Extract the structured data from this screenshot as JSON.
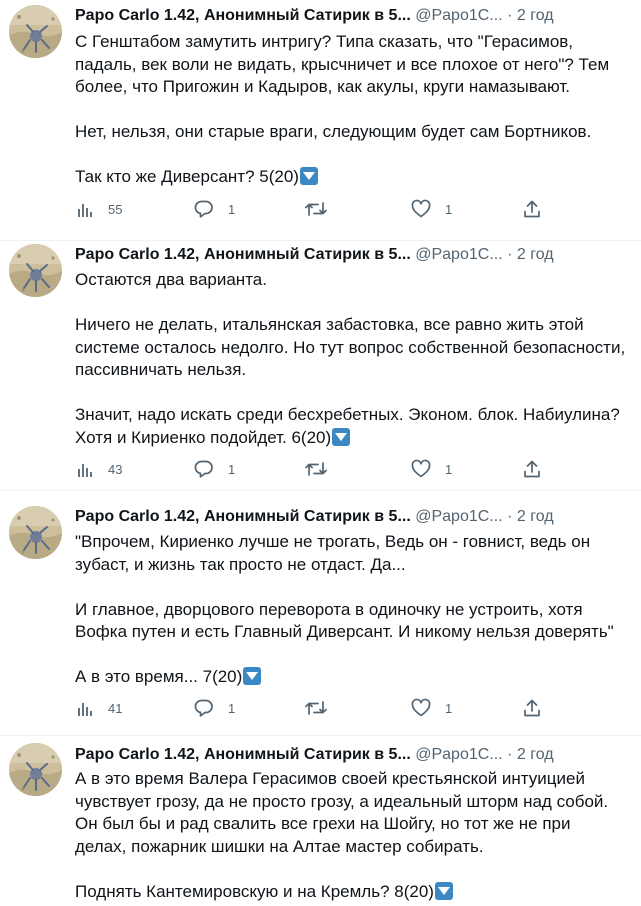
{
  "tweets": [
    {
      "author": "Papo Carlo 1.42, Анонимный Сатирик в 5...",
      "handle": "@Papo1C...",
      "dot": "·",
      "time": "2 год",
      "paragraphs": [
        "С Генштабом замутить интригу? Типа сказать, что \"Герасимов,\nпадаль, век воли не видать, крысчничет и все плохое от него\"? Тем\nболее, что Пригожин и Кадыров, как акулы, круги намазывают.",
        "Нет, нельзя, они старые враги, следующим будет сам Бортников.",
        "Так кто же Диверсант? 5(20)"
      ],
      "views": "55",
      "replies": "1",
      "retweets": "",
      "likes": "1"
    },
    {
      "author": "Papo Carlo 1.42, Анонимный Сатирик в 5...",
      "handle": "@Papo1C...",
      "dot": "·",
      "time": "2 год",
      "paragraphs": [
        "Остаются два варианта.",
        "Ничего не делать, итальянская забастовка, все равно жить этой\nсистеме осталось недолго. Но тут вопрос собственной безопасности,\nпассивничать нельзя.",
        "Значит, надо искать среди бесхребетных. Эконом. блок. Набиулина?\nХотя и Кириенко подойдет. 6(20)"
      ],
      "views": "43",
      "replies": "1",
      "retweets": "",
      "likes": "1"
    },
    {
      "author": "Papo Carlo 1.42, Анонимный Сатирик в 5...",
      "handle": "@Papo1C...",
      "dot": "·",
      "time": "2 год",
      "paragraphs": [
        "\"Впрочем, Кириенко лучше не трогать, Ведь он - говнист, ведь он\nзубаст, и жизнь так просто не отдаст. Да...",
        "И главное, дворцового переворота в одиночку не устроить, хотя\nВофка путен и есть Главный Диверсант. И никому нельзя доверять\"",
        "А в это время... 7(20)"
      ],
      "views": "41",
      "replies": "1",
      "retweets": "",
      "likes": "1"
    },
    {
      "author": "Papo Carlo 1.42, Анонимный Сатирик в 5...",
      "handle": "@Papo1C...",
      "dot": "·",
      "time": "2 год",
      "paragraphs": [
        "А в это время Валера Герасимов своей крестьянской интуицией\nчувствует грозу, да не просто грозу, а идеальный шторм над собой.\nОн был бы и рад свалить все грехи на Шойгу, но тот же не при\nделах, пожарник шишки на Алтае мастер собирать.",
        "Поднять Кантемировскую и на Кремль? 8(20)"
      ],
      "views": "",
      "replies": "",
      "retweets": "",
      "likes": ""
    }
  ],
  "icons": {
    "views": "bar-chart-icon",
    "reply": "speech-bubble-icon",
    "retweet": "retweet-arrows-icon",
    "like": "heart-icon",
    "share": "share-upload-icon",
    "emoji": "down-arrow-button-emoji"
  },
  "colors": {
    "text": "#0f1419",
    "secondary": "#536471",
    "divider": "#eff3f4",
    "emoji_blue": "#3b88c3"
  }
}
